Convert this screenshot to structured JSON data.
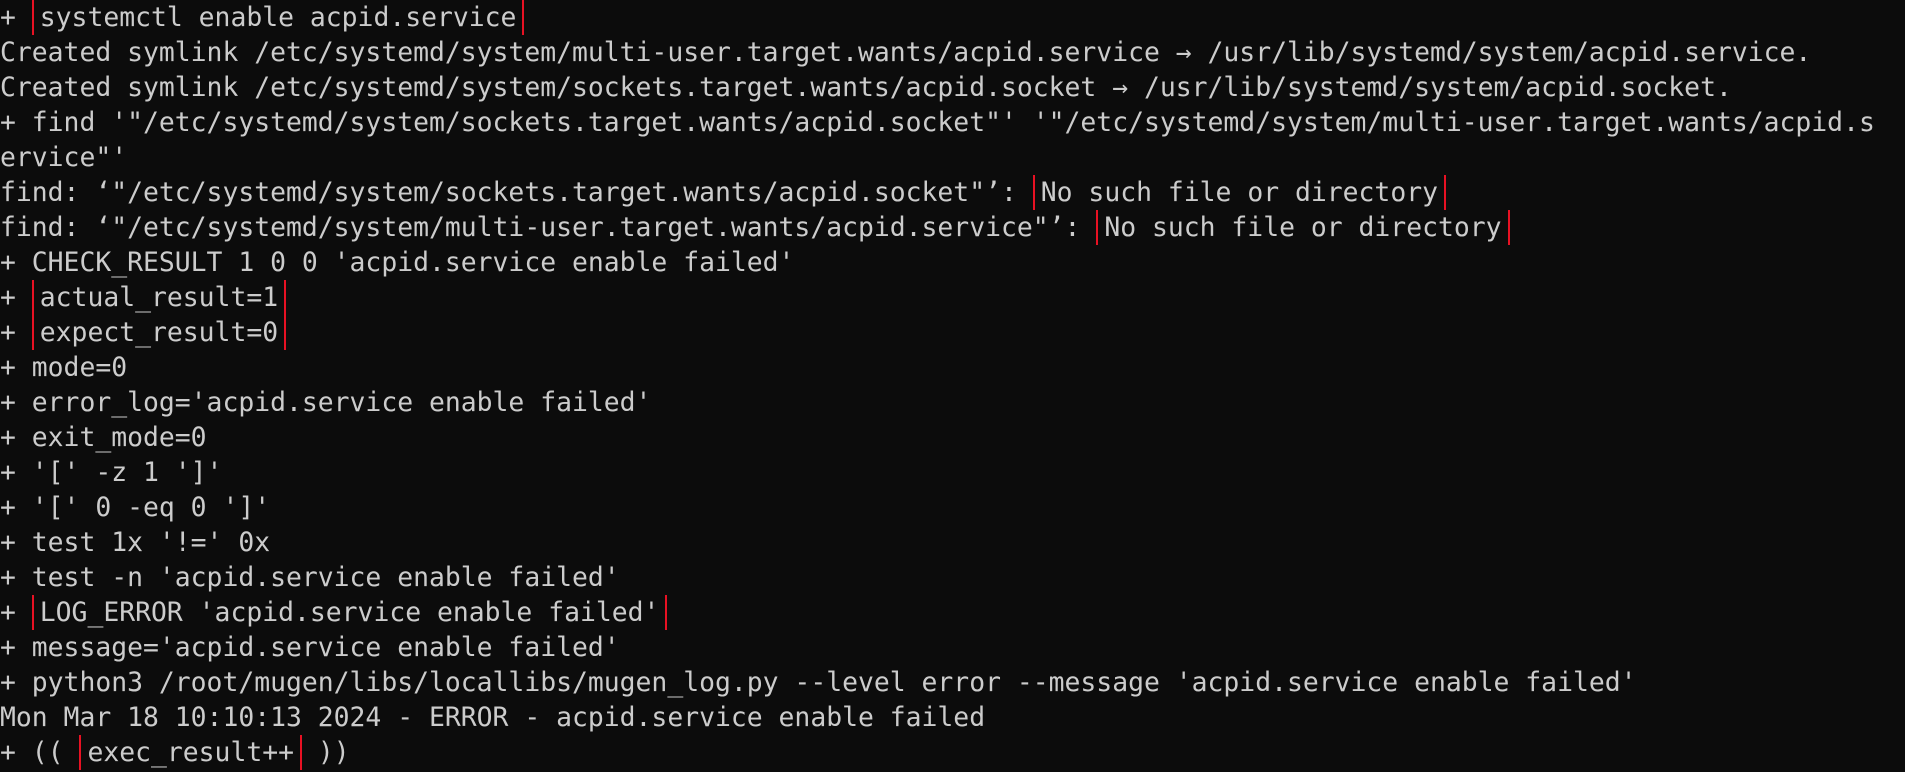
{
  "terminal": {
    "lines": [
      [
        {
          "t": "+ "
        },
        {
          "t": "systemctl enable acpid.service",
          "hl": true
        }
      ],
      [
        {
          "t": "Created symlink /etc/systemd/system/multi-user.target.wants/acpid.service → /usr/lib/systemd/system/acpid.service."
        }
      ],
      [
        {
          "t": "Created symlink /etc/systemd/system/sockets.target.wants/acpid.socket → /usr/lib/systemd/system/acpid.socket."
        }
      ],
      [
        {
          "t": "+ find '\"/etc/systemd/system/sockets.target.wants/acpid.socket\"' '\"/etc/systemd/system/multi-user.target.wants/acpid.s"
        }
      ],
      [
        {
          "t": "ervice\"'"
        }
      ],
      [
        {
          "t": "find: ‘\"/etc/systemd/system/sockets.target.wants/acpid.socket\"’: "
        },
        {
          "t": "No such file or directory",
          "hl": true
        }
      ],
      [
        {
          "t": "find: ‘\"/etc/systemd/system/multi-user.target.wants/acpid.service\"’: "
        },
        {
          "t": "No such file or directory",
          "hl": true
        }
      ],
      [
        {
          "t": "+ CHECK_RESULT 1 0 0 'acpid.service enable failed'"
        }
      ],
      [
        {
          "t": "+ "
        },
        {
          "t": "actual_result=1",
          "hl": true
        }
      ],
      [
        {
          "t": "+ "
        },
        {
          "t": "expect_result=0",
          "hl": true
        }
      ],
      [
        {
          "t": "+ mode=0"
        }
      ],
      [
        {
          "t": "+ error_log='acpid.service enable failed'"
        }
      ],
      [
        {
          "t": "+ exit_mode=0"
        }
      ],
      [
        {
          "t": "+ '[' -z 1 ']'"
        }
      ],
      [
        {
          "t": "+ '[' 0 -eq 0 ']'"
        }
      ],
      [
        {
          "t": "+ test 1x '!=' 0x"
        }
      ],
      [
        {
          "t": "+ test -n 'acpid.service enable failed'"
        }
      ],
      [
        {
          "t": "+ "
        },
        {
          "t": "LOG_ERROR 'acpid.service enable failed'",
          "hl": true
        }
      ],
      [
        {
          "t": "+ message='acpid.service enable failed'"
        }
      ],
      [
        {
          "t": "+ python3 /root/mugen/libs/locallibs/mugen_log.py --level error --message 'acpid.service enable failed'"
        }
      ],
      [
        {
          "t": "Mon Mar 18 10:10:13 2024 - ERROR - acpid.service enable failed"
        }
      ],
      [
        {
          "t": "+ (( "
        },
        {
          "t": "exec_result++",
          "hl": true
        },
        {
          "t": " ))"
        }
      ]
    ]
  },
  "colors": {
    "background": "#0c0c0c",
    "text": "#cccccc",
    "highlight_box": "#e81123"
  }
}
